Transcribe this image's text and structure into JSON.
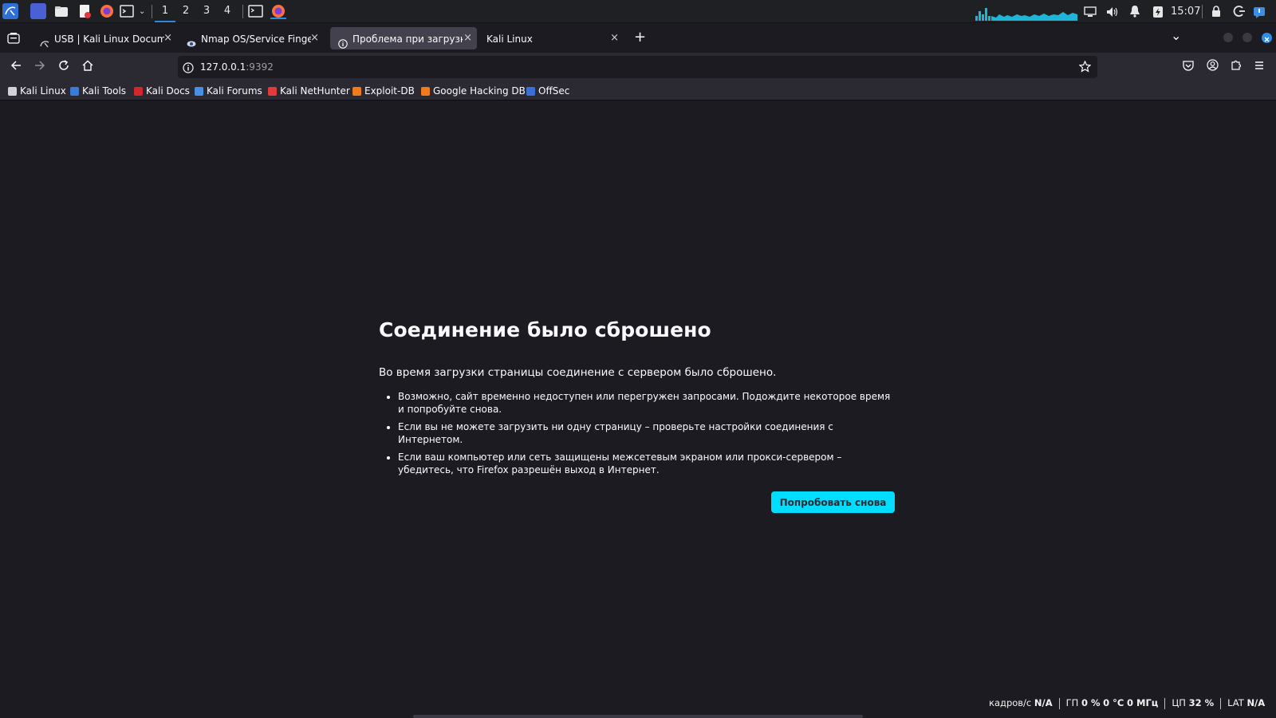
{
  "taskbar": {
    "workspaces": [
      "1",
      "2",
      "3",
      "4"
    ],
    "clock": "15:07",
    "accent": "#2a8ae0"
  },
  "tabs": [
    {
      "title": "USB | Kali Linux Documen",
      "close": "×"
    },
    {
      "title": "Nmap OS/Service Fingerp",
      "close": "×"
    },
    {
      "title": "Проблема при загрузке с",
      "close": "×"
    },
    {
      "title": "Kali Linux",
      "close": "×"
    }
  ],
  "tabstrip": {
    "new_tab": "+",
    "list_tabs": "⌄"
  },
  "navbar": {
    "url_host": "127.0.0.1",
    "url_port": ":9392"
  },
  "bookmarks": [
    {
      "label": "Kali Linux",
      "color": "#cfd2d6"
    },
    {
      "label": "Kali Tools",
      "color": "#3a7bd5"
    },
    {
      "label": "Kali Docs",
      "color": "#d4272c"
    },
    {
      "label": "Kali Forums",
      "color": "#4a90e2"
    },
    {
      "label": "Kali NetHunter",
      "color": "#e23b3b"
    },
    {
      "label": "Exploit-DB",
      "color": "#f07b1d"
    },
    {
      "label": "Google Hacking DB",
      "color": "#f07b1d"
    },
    {
      "label": "OffSec",
      "color": "#3b6fd8"
    }
  ],
  "error": {
    "title": "Соединение было сброшено",
    "description": "Во время загрузки страницы соединение с сервером было сброшено.",
    "items": [
      "Возможно, сайт временно недоступен или перегружен запросами. Подождите некоторое время и попробуйте снова.",
      "Если вы не можете загрузить ни одну страницу – проверьте настройки соединения с Интернетом.",
      "Если ваш компьютер или сеть защищены межсетевым экраном или прокси-сервером – убедитесь, что Firefox разрешён выход в Интернет."
    ],
    "retry_label": "Попробовать снова",
    "button_color": "#00ddff"
  },
  "osd": {
    "fps_label": "кадров/с",
    "fps_value": "N/A",
    "gpu_label": "ГП",
    "gpu_value": "0 %",
    "gpu_temp": "0 °C",
    "gpu_clock": "0 МГц",
    "cpu_label": "ЦП",
    "cpu_value": "32 %",
    "lat_label": "LAT",
    "lat_value": "N/A"
  }
}
